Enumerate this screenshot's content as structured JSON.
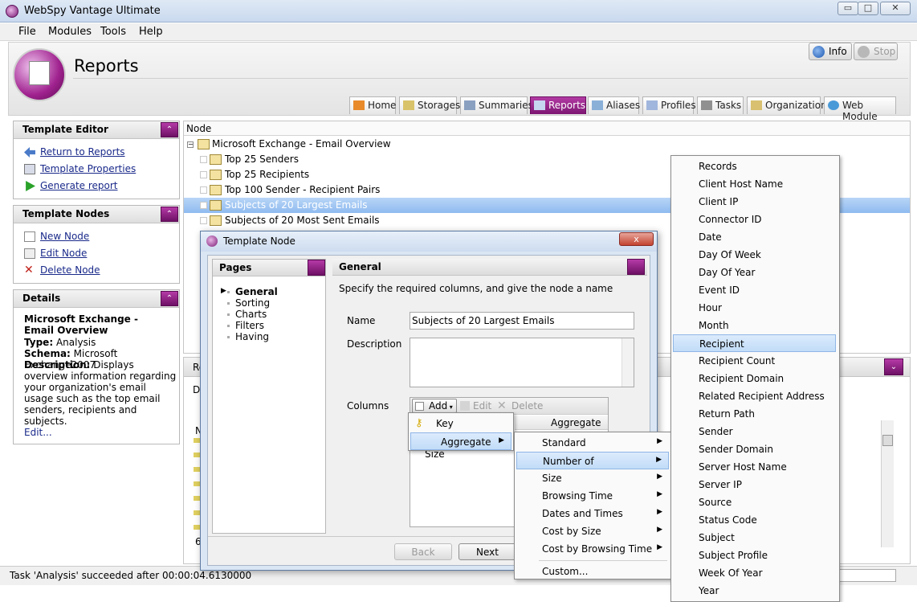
{
  "window": {
    "title": "WebSpy Vantage Ultimate",
    "min": "▭",
    "max": "□",
    "close": "✕"
  },
  "menubar": [
    "File",
    "Modules",
    "Tools",
    "Help"
  ],
  "header": {
    "title": "Reports",
    "info": "Info",
    "stop": "Stop"
  },
  "tabs": [
    "Home",
    "Storages",
    "Summaries",
    "Reports",
    "Aliases",
    "Profiles",
    "Tasks",
    "Organization",
    "Web Module"
  ],
  "template_editor": {
    "title": "Template Editor",
    "links": [
      "Return to Reports",
      "Template Properties",
      "Generate report"
    ]
  },
  "template_nodes": {
    "title": "Template Nodes",
    "links": [
      "New Node",
      "Edit Node",
      "Delete Node"
    ]
  },
  "details": {
    "title": "Details",
    "name": "Microsoft Exchange - Email Overview",
    "type_label": "Type:",
    "type": "Analysis",
    "schema_label": "Schema:",
    "schema": "Microsoft Exchange2007",
    "desc_label": "Description:",
    "desc": "Displays overview information regarding your organization's email usage such as the top email senders, recipients and subjects.",
    "edit": "Edit..."
  },
  "tree": {
    "header": "Node",
    "root": "Microsoft Exchange - Email Overview",
    "items": [
      "Top 25 Senders",
      "Top 25 Recipients",
      "Top 100 Sender - Recipient Pairs",
      "Subjects of 20 Largest Emails",
      "Subjects of 20 Most Sent Emails"
    ]
  },
  "lower": {
    "fragment1": "Re",
    "fragment2": "De",
    "fragment3": "N",
    "fragment4": "6"
  },
  "status": {
    "text": "Task 'Analysis' succeeded after 00:00:04.6130000"
  },
  "dialog": {
    "title": "Template Node",
    "close": "x",
    "pages_title": "Pages",
    "pages": [
      "General",
      "Sorting",
      "Charts",
      "Filters",
      "Having"
    ],
    "general_title": "General",
    "instruction": "Specify the required columns, and give the node a name",
    "name_label": "Name",
    "name_value": "Subjects of 20 Largest Emails",
    "description_label": "Description",
    "columns_label": "Columns",
    "add": "Add",
    "edit": "Edit",
    "delete": "Delete",
    "col_header": "Aggregate",
    "col_row": "Size",
    "back": "Back",
    "next": "Next"
  },
  "add_menu": {
    "items": [
      "Key",
      "Aggregate"
    ]
  },
  "aggregate_menu": {
    "items": [
      "Standard",
      "Number of",
      "Size",
      "Browsing Time",
      "Dates and Times",
      "Cost by Size",
      "Cost by Browsing Time",
      "Custom..."
    ]
  },
  "field_list": {
    "items": [
      "Records",
      "Client Host Name",
      "Client IP",
      "Connector ID",
      "Date",
      "Day Of Week",
      "Day Of Year",
      "Event ID",
      "Hour",
      "Month",
      "Recipient",
      "Recipient Count",
      "Recipient Domain",
      "Related Recipient Address",
      "Return Path",
      "Sender",
      "Sender Domain",
      "Server Host Name",
      "Server IP",
      "Source",
      "Status Code",
      "Subject",
      "Subject Profile",
      "Week Of Year",
      "Year"
    ],
    "selected": "Recipient"
  }
}
